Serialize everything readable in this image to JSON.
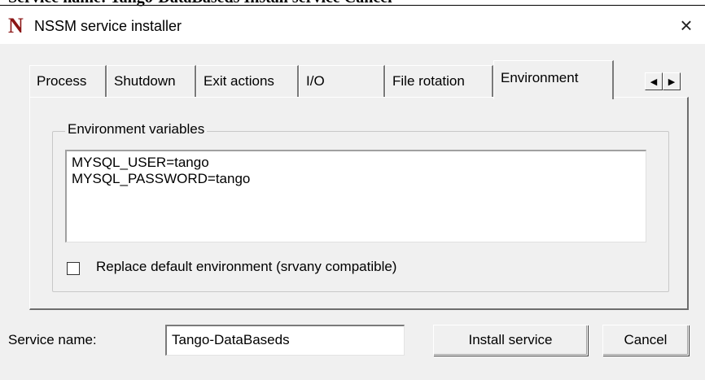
{
  "window": {
    "logo": "N",
    "title": "NSSM service installer",
    "close_glyph": "×",
    "close_icon": "close-icon"
  },
  "top_clip_text": "Service name: Tango-DataBaseds Install service Cancel",
  "tabs": [
    {
      "label": "Process",
      "active": false
    },
    {
      "label": "Shutdown",
      "active": false
    },
    {
      "label": "Exit actions",
      "active": false
    },
    {
      "label": "I/O",
      "active": false
    },
    {
      "label": "File rotation",
      "active": false
    },
    {
      "label": "Environment",
      "active": true
    }
  ],
  "tab_scroll": {
    "left_glyph": "◀",
    "right_glyph": "▶",
    "left_icon": "scroll-left-icon",
    "right_icon": "scroll-right-icon"
  },
  "environment": {
    "group_label": "Environment variables",
    "variables": [
      "MYSQL_USER=tango",
      "MYSQL_PASSWORD=tango"
    ],
    "replace_default_label": "Replace default environment (srvany compatible)",
    "replace_default_checked": false
  },
  "footer": {
    "service_name_label": "Service name:",
    "service_name_value": "Tango-DataBaseds",
    "install_label": "Install service",
    "cancel_label": "Cancel"
  }
}
